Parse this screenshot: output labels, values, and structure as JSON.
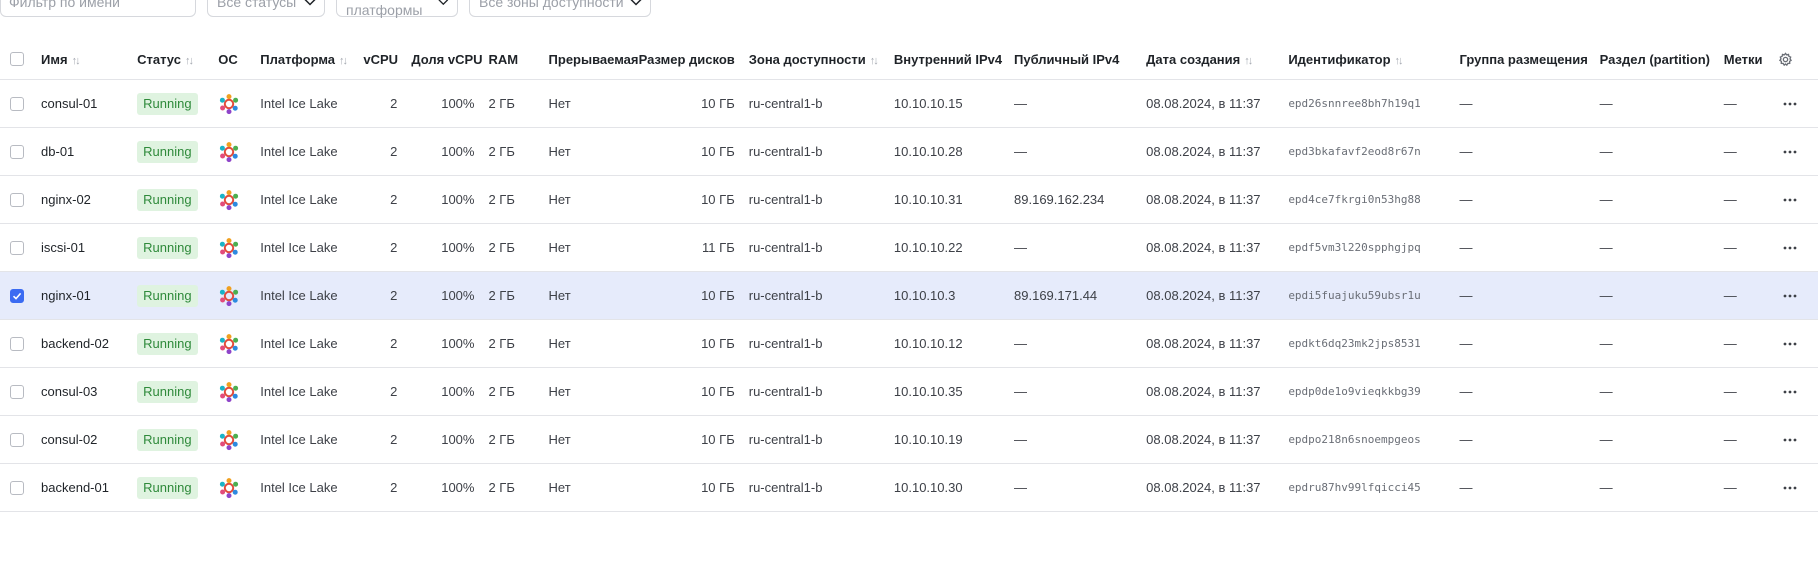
{
  "filters": {
    "name_placeholder": "Фильтр по имени",
    "status": "Все статусы",
    "platform": "Все платформы",
    "zone": "Все зоны доступности"
  },
  "table": {
    "headers": {
      "name": "Имя",
      "status": "Статус",
      "os": "ОС",
      "platform": "Платформа",
      "vcpu": "vCPU",
      "vcpu_share": "Доля vCPU",
      "ram": "RAM",
      "preemptible": "Прерываемая",
      "disk_size": "Размер дисков",
      "zone": "Зона доступности",
      "internal_ip": "Внутренний IPv4",
      "public_ip": "Публичный IPv4",
      "created": "Дата создания",
      "id": "Идентификатор",
      "placement_group": "Группа размещения",
      "partition": "Раздел (partition)",
      "labels": "Метки"
    },
    "rows": [
      {
        "selected": false,
        "name": "consul-01",
        "status": "Running",
        "os": "ubuntu-icon",
        "platform": "Intel Ice Lake",
        "vcpu": "2",
        "vcpu_share": "100%",
        "ram": "2 ГБ",
        "preemptible": "Нет",
        "disk_size": "10 ГБ",
        "zone": "ru-central1-b",
        "internal_ip": "10.10.10.15",
        "public_ip": "—",
        "created": "08.08.2024, в 11:37",
        "id": "epd26snnree8bh7h19q1",
        "placement_group": "—",
        "partition": "—",
        "labels": "—"
      },
      {
        "selected": false,
        "name": "db-01",
        "status": "Running",
        "os": "ubuntu-icon",
        "platform": "Intel Ice Lake",
        "vcpu": "2",
        "vcpu_share": "100%",
        "ram": "2 ГБ",
        "preemptible": "Нет",
        "disk_size": "10 ГБ",
        "zone": "ru-central1-b",
        "internal_ip": "10.10.10.28",
        "public_ip": "—",
        "created": "08.08.2024, в 11:37",
        "id": "epd3bkafavf2eod8r67n",
        "placement_group": "—",
        "partition": "—",
        "labels": "—"
      },
      {
        "selected": false,
        "name": "nginx-02",
        "status": "Running",
        "os": "ubuntu-icon",
        "platform": "Intel Ice Lake",
        "vcpu": "2",
        "vcpu_share": "100%",
        "ram": "2 ГБ",
        "preemptible": "Нет",
        "disk_size": "10 ГБ",
        "zone": "ru-central1-b",
        "internal_ip": "10.10.10.31",
        "public_ip": "89.169.162.234",
        "created": "08.08.2024, в 11:37",
        "id": "epd4ce7fkrgi0n53hg88",
        "placement_group": "—",
        "partition": "—",
        "labels": "—"
      },
      {
        "selected": false,
        "name": "iscsi-01",
        "status": "Running",
        "os": "ubuntu-icon",
        "platform": "Intel Ice Lake",
        "vcpu": "2",
        "vcpu_share": "100%",
        "ram": "2 ГБ",
        "preemptible": "Нет",
        "disk_size": "11 ГБ",
        "zone": "ru-central1-b",
        "internal_ip": "10.10.10.22",
        "public_ip": "—",
        "created": "08.08.2024, в 11:37",
        "id": "epdf5vm3l220spphgjpq",
        "placement_group": "—",
        "partition": "—",
        "labels": "—"
      },
      {
        "selected": true,
        "name": "nginx-01",
        "status": "Running",
        "os": "ubuntu-icon",
        "platform": "Intel Ice Lake",
        "vcpu": "2",
        "vcpu_share": "100%",
        "ram": "2 ГБ",
        "preemptible": "Нет",
        "disk_size": "10 ГБ",
        "zone": "ru-central1-b",
        "internal_ip": "10.10.10.3",
        "public_ip": "89.169.171.44",
        "created": "08.08.2024, в 11:37",
        "id": "epdi5fuajuku59ubsr1u",
        "placement_group": "—",
        "partition": "—",
        "labels": "—"
      },
      {
        "selected": false,
        "name": "backend-02",
        "status": "Running",
        "os": "ubuntu-icon",
        "platform": "Intel Ice Lake",
        "vcpu": "2",
        "vcpu_share": "100%",
        "ram": "2 ГБ",
        "preemptible": "Нет",
        "disk_size": "10 ГБ",
        "zone": "ru-central1-b",
        "internal_ip": "10.10.10.12",
        "public_ip": "—",
        "created": "08.08.2024, в 11:37",
        "id": "epdkt6dq23mk2jps8531",
        "placement_group": "—",
        "partition": "—",
        "labels": "—"
      },
      {
        "selected": false,
        "name": "consul-03",
        "status": "Running",
        "os": "ubuntu-icon",
        "platform": "Intel Ice Lake",
        "vcpu": "2",
        "vcpu_share": "100%",
        "ram": "2 ГБ",
        "preemptible": "Нет",
        "disk_size": "10 ГБ",
        "zone": "ru-central1-b",
        "internal_ip": "10.10.10.35",
        "public_ip": "—",
        "created": "08.08.2024, в 11:37",
        "id": "epdp0de1o9vieqkkbg39",
        "placement_group": "—",
        "partition": "—",
        "labels": "—"
      },
      {
        "selected": false,
        "name": "consul-02",
        "status": "Running",
        "os": "ubuntu-icon",
        "platform": "Intel Ice Lake",
        "vcpu": "2",
        "vcpu_share": "100%",
        "ram": "2 ГБ",
        "preemptible": "Нет",
        "disk_size": "10 ГБ",
        "zone": "ru-central1-b",
        "internal_ip": "10.10.10.19",
        "public_ip": "—",
        "created": "08.08.2024, в 11:37",
        "id": "epdpo218n6snoempgeos",
        "placement_group": "—",
        "partition": "—",
        "labels": "—"
      },
      {
        "selected": false,
        "name": "backend-01",
        "status": "Running",
        "os": "ubuntu-icon",
        "platform": "Intel Ice Lake",
        "vcpu": "2",
        "vcpu_share": "100%",
        "ram": "2 ГБ",
        "preemptible": "Нет",
        "disk_size": "10 ГБ",
        "zone": "ru-central1-b",
        "internal_ip": "10.10.10.30",
        "public_ip": "—",
        "created": "08.08.2024, в 11:37",
        "id": "epdru87hv99lfqicci45",
        "placement_group": "—",
        "partition": "—",
        "labels": "—"
      }
    ]
  },
  "colors": {
    "status_running_bg": "#dff3e0",
    "status_running_text": "#2f8a3b",
    "selected_row_bg": "#e6ebfb",
    "checkbox_checked": "#3b6bf2"
  }
}
